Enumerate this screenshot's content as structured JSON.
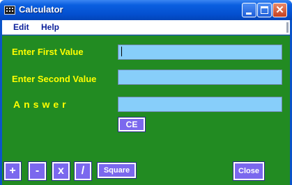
{
  "window": {
    "title": "Calculator"
  },
  "menu": {
    "edit": "Edit",
    "help": "Help"
  },
  "titlebar_buttons": {
    "minimize": "minimize-icon",
    "maximize": "maximize-icon",
    "close": "✕"
  },
  "form": {
    "first_label": "Enter First Value",
    "second_label": "Enter Second Value",
    "answer_label": "Answer",
    "first_value": "",
    "second_value": "",
    "answer_value": ""
  },
  "buttons": {
    "ce": "CE",
    "plus": "+",
    "minus": "-",
    "multiply": "x",
    "divide": "/",
    "square": "Square",
    "close": "Close"
  },
  "colors": {
    "form_background": "#228b22",
    "label": "#ffff00",
    "field": "#87cefa",
    "button": "#7b68ee"
  }
}
